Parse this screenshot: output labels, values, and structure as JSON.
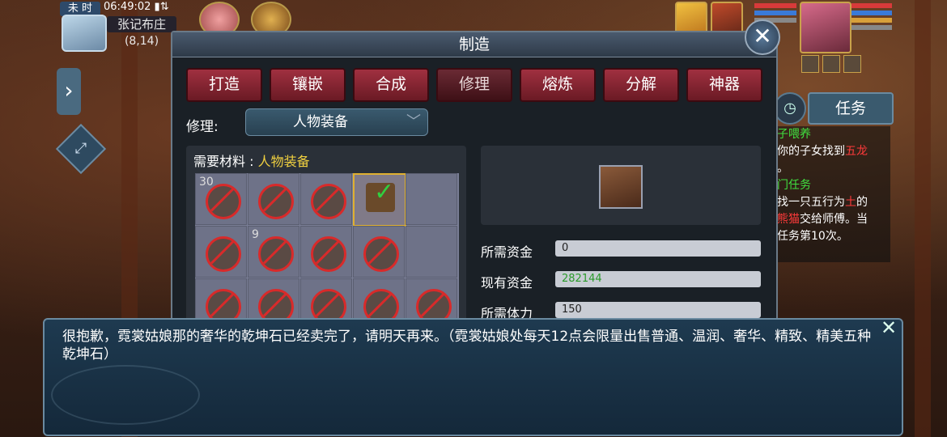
{
  "hud": {
    "time_badge": "未 时",
    "clock": "06:49:02",
    "location_name": "张记布庄",
    "coords": "(8,14)"
  },
  "dialog_panel": {
    "title": "制造",
    "tabs": [
      {
        "label": "打造",
        "active": false
      },
      {
        "label": "镶嵌",
        "active": false
      },
      {
        "label": "合成",
        "active": false
      },
      {
        "label": "修理",
        "active": true
      },
      {
        "label": "熔炼",
        "active": false
      },
      {
        "label": "分解",
        "active": false
      },
      {
        "label": "神器",
        "active": false
      }
    ],
    "repair_label": "修理:",
    "repair_select": "人物装备",
    "materials_label": "需要材料 : ",
    "materials_value": "人物装备",
    "grid_counts": {
      "cell0": "30",
      "cell6": "9"
    },
    "stats": [
      {
        "label": "所需资金",
        "value": "0"
      },
      {
        "label": "现有资金",
        "value": "282144"
      },
      {
        "label": "所需体力",
        "value": "150"
      }
    ]
  },
  "tasks": {
    "tab_label": "任务",
    "lines": [
      "子喂养",
      "你的子女找到五龙",
      "。",
      "门任务",
      "找一只五行为土的",
      "熊猫交给师傅。当",
      "任务第10次。"
    ]
  },
  "npc_dialog": {
    "text": "很抱歉，霓裳姑娘那的奢华的乾坤石已经卖完了，请明天再来。（霓裳姑娘处每天12点会限量出售普通、温润、奢华、精致、精美五种乾坤石）"
  },
  "colors": {
    "tab_red": "#a03040",
    "highlight_yellow": "#f0d040",
    "money_green": "#2a9a2a",
    "task_green": "#40e040",
    "task_red": "#ff3a3a"
  }
}
